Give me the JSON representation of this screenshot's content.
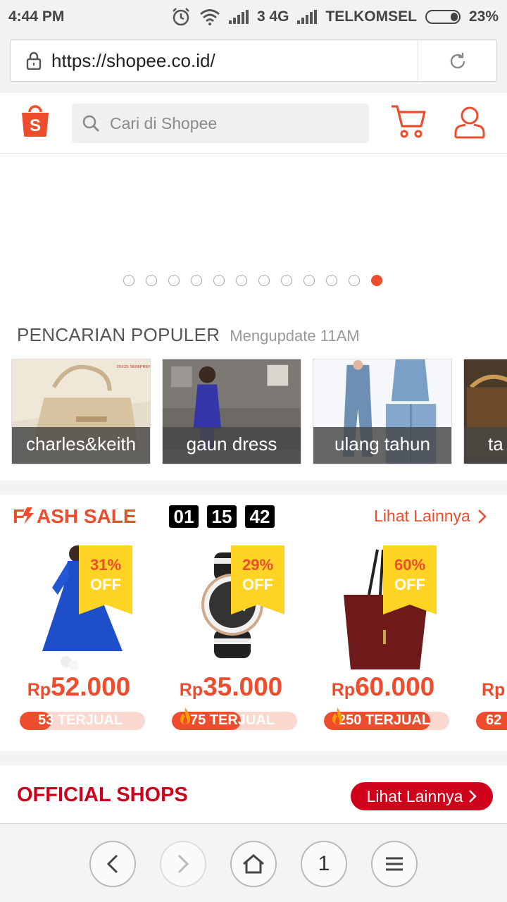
{
  "status_bar": {
    "time": "4:44 PM",
    "network": "3 4G",
    "carrier": "TELKOMSEL",
    "battery": "23%",
    "battery_level": 0.23
  },
  "browser": {
    "url": "https://shopee.co.id/"
  },
  "header": {
    "search_placeholder": "Cari di Shopee",
    "brand_color": "#ee4d2d"
  },
  "banner": {
    "slide_count": 12,
    "active_slide": 12
  },
  "popular": {
    "title": "PENCARIAN POPULER",
    "subtitle": "Mengupdate 11AM",
    "items": [
      {
        "label": "charles&keith"
      },
      {
        "label": "gaun dress"
      },
      {
        "label": "ulang tahun"
      },
      {
        "label": "ta"
      }
    ]
  },
  "flash_sale": {
    "title_parts": [
      "F",
      "ASH SALE"
    ],
    "countdown": [
      "01",
      "15",
      "42"
    ],
    "more_label": "Lihat Lainnya",
    "items": [
      {
        "discount": "31%",
        "off": "OFF",
        "currency": "Rp",
        "price": "52.000",
        "sold": "53 TERJUAL",
        "sold_fraction": 0.25,
        "hot": false
      },
      {
        "discount": "29%",
        "off": "OFF",
        "currency": "Rp",
        "price": "35.000",
        "sold": "75 TERJUAL",
        "sold_fraction": 0.55,
        "hot": true
      },
      {
        "discount": "60%",
        "off": "OFF",
        "currency": "Rp",
        "price": "60.000",
        "sold": "250 TERJUAL",
        "sold_fraction": 0.85,
        "hot": true
      },
      {
        "discount": "",
        "off": "",
        "currency": "Rp",
        "price": "",
        "sold": "62",
        "sold_fraction": 0.5,
        "hot": false
      }
    ]
  },
  "official_shops": {
    "title": "OFFICIAL SHOPS",
    "more_label": "Lihat Lainnya",
    "accent_color": "#d0011b"
  },
  "bottom_nav": {
    "tab_count": "1"
  }
}
